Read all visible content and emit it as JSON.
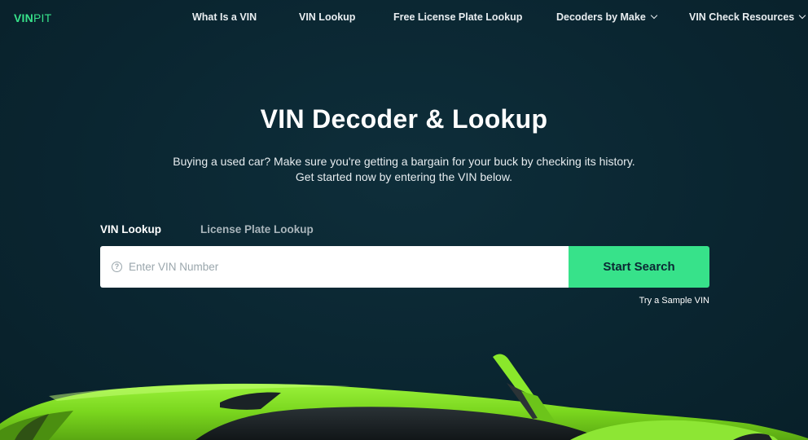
{
  "header": {
    "logo_strong": "VIN",
    "logo_light": "PIT",
    "nav": [
      {
        "label": "What Is a VIN"
      },
      {
        "label": "VIN Lookup"
      },
      {
        "label": "Free License Plate Lookup"
      },
      {
        "label": "Decoders by Make"
      },
      {
        "label": "VIN Check Resources"
      }
    ]
  },
  "hero": {
    "title": "VIN Decoder & Lookup",
    "subtitle_line1": "Buying a used car? Make sure you're getting a bargain for your buck by checking its history.",
    "subtitle_line2": "Get started now by entering the VIN below."
  },
  "tabs": [
    {
      "label": "VIN Lookup",
      "active": true
    },
    {
      "label": "License Plate Lookup",
      "active": false
    }
  ],
  "search": {
    "placeholder": "Enter VIN Number",
    "value": "",
    "button_label": "Start Search"
  },
  "sample_link": "Try a Sample VIN",
  "colors": {
    "background": "#0b2733",
    "accent": "#37e28a",
    "car_green": "#7ee021"
  },
  "icons": {
    "help": "question-circle-icon",
    "dropdown": "chevron-down-icon"
  }
}
